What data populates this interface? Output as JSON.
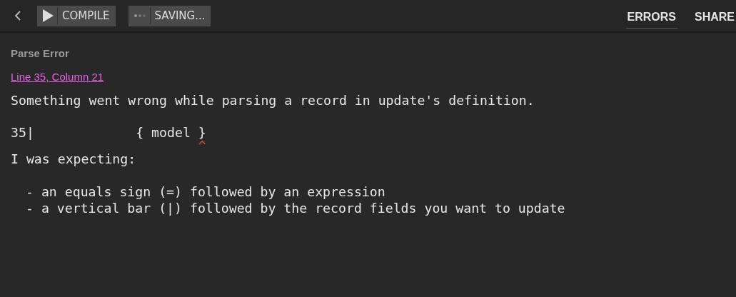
{
  "toolbar": {
    "buttons": [
      {
        "kind": "compile",
        "label": "COMPILE"
      },
      {
        "kind": "saving",
        "label": "SAVING..."
      }
    ],
    "tabs": [
      {
        "label": "ERRORS",
        "selected": true
      },
      {
        "label": "SHARE",
        "selected": false
      }
    ]
  },
  "error": {
    "title": "Parse Error",
    "location": "Line 35, Column 21",
    "message": "Something went wrong while parsing a record in update's definition.",
    "code_line": "35|             { model }",
    "caret_line": "                        ^",
    "expecting": "I was expecting:",
    "options": [
      "- an equals sign (=) followed by an expression",
      "- a vertical bar (|) followed by the record fields you want to update"
    ]
  }
}
